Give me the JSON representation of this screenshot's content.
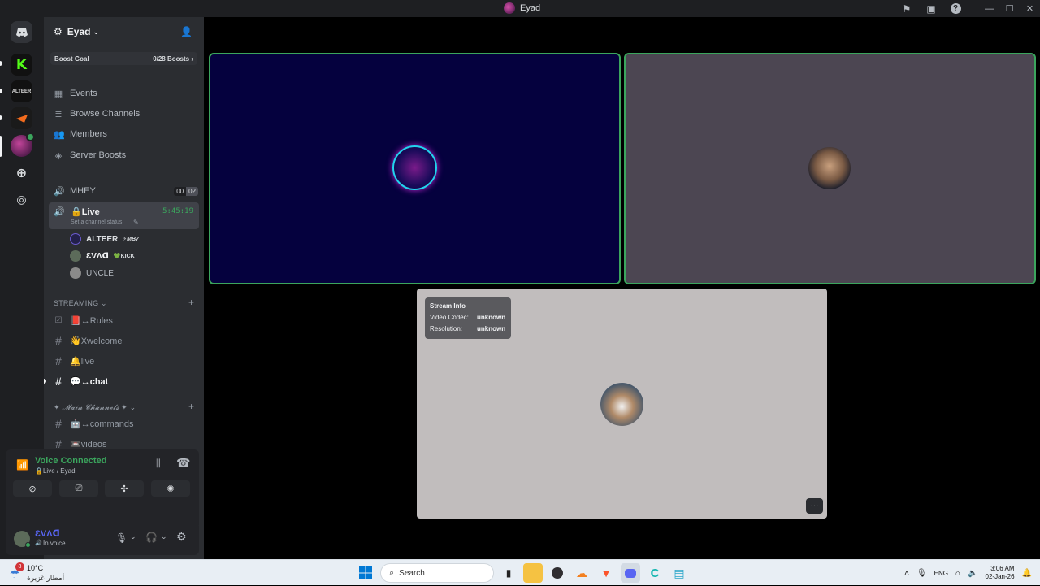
{
  "window": {
    "title": "Eyad"
  },
  "server": {
    "name": "Eyad",
    "boost_goal_label": "Boost Goal",
    "boost_count": "0/28 Boosts",
    "nav": [
      {
        "label": "Events",
        "icon": "calendar-icon"
      },
      {
        "label": "Browse Channels",
        "icon": "list-icon"
      },
      {
        "label": "Members",
        "icon": "members-icon"
      },
      {
        "label": "Server Boosts",
        "icon": "boost-icon"
      }
    ],
    "voice_channels": {
      "mhey": {
        "name": "MHEY",
        "count_a": "00",
        "count_b": "02"
      },
      "live": {
        "name": "🔒Live",
        "timer": "5:45:19",
        "status": "Set a channel status"
      }
    },
    "voice_users": [
      {
        "name": "ALTEER",
        "tag": "⚡MB7",
        "color": "#23204a"
      },
      {
        "name": "ƐVΛᗡ",
        "tag": "💚KICK",
        "color": "#5c6b5a"
      },
      {
        "name": "UNCLE",
        "tag": "",
        "color": "#8a8a8a"
      }
    ],
    "categories": {
      "streaming": "STREAMING",
      "main": "✦ 𝓜𝓪𝓲𝓷 𝓒𝓱𝓪𝓷𝓷𝓮𝓵𝓼 ✦"
    },
    "streaming_channels": [
      {
        "name": "📕↔Rules",
        "active": false,
        "unread": false
      },
      {
        "name": "👋Xwelcome",
        "active": false,
        "unread": false
      },
      {
        "name": "🔔live",
        "active": false,
        "unread": false
      },
      {
        "name": "💬↔chat",
        "active": true,
        "unread": true
      }
    ],
    "main_channels": [
      {
        "name": "🤖↔commands"
      },
      {
        "name": "📼videos"
      }
    ]
  },
  "voice_panel": {
    "status": "Voice Connected",
    "location": "🔒Live / Eyad",
    "user_name": "ƐVΛᗡ",
    "user_status": "In voice"
  },
  "stream_info": {
    "title": "Stream Info",
    "codec_label": "Video Codec:",
    "codec_value": "unknown",
    "res_label": "Resolution:",
    "res_value": "unknown",
    "more_label": "···"
  },
  "taskbar": {
    "weather_temp": "10°C",
    "weather_desc": "أمطار غزيرة",
    "weather_badge": "8",
    "search_placeholder": "Search",
    "lang": "ENG",
    "time": "3:06 AM",
    "date": "02-Jan-26"
  },
  "colors": {
    "accent_green": "#3ba55d",
    "tile_blue": "#05013e",
    "tile_gray": "#4c4652",
    "tile_light": "#c1bdbd"
  }
}
